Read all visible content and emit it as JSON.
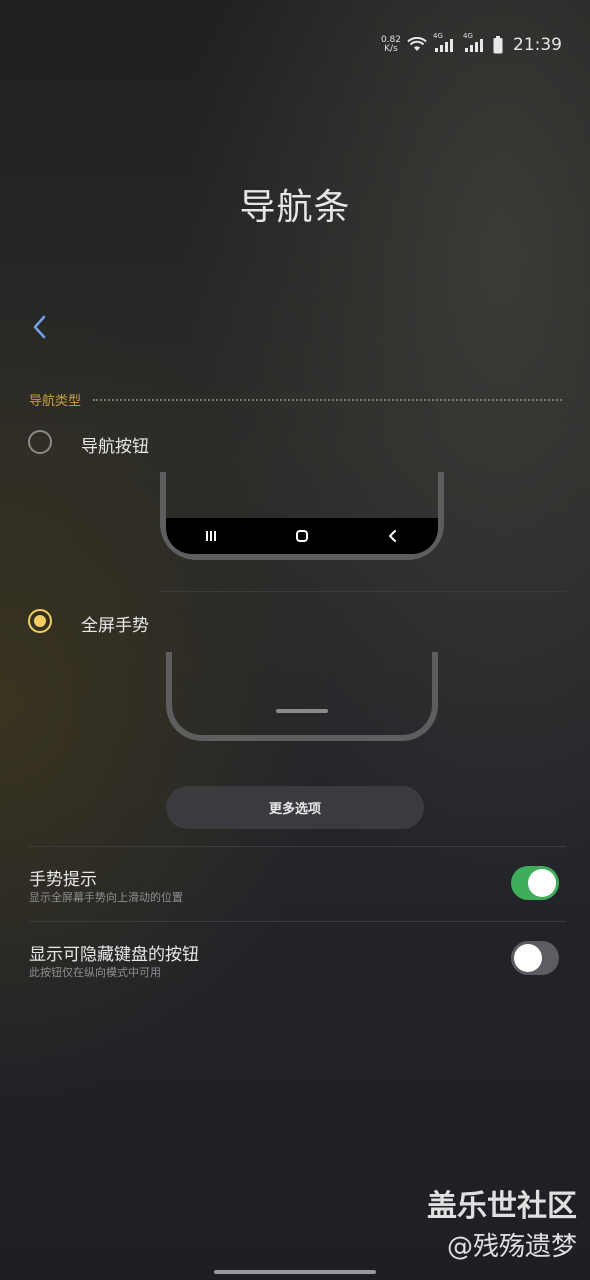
{
  "status_bar": {
    "speed_value": "0.82",
    "speed_unit": "K/s",
    "wifi_icon": "wifi-icon",
    "signal_1_label": "4G",
    "signal_2_label": "4G",
    "battery_icon": "battery-icon",
    "time": "21:39"
  },
  "page": {
    "title": "导航条"
  },
  "section": {
    "label": "导航类型"
  },
  "options": [
    {
      "label": "导航按钮",
      "selected": false
    },
    {
      "label": "全屏手势",
      "selected": true
    }
  ],
  "more_options_label": "更多选项",
  "settings": [
    {
      "title": "手势提示",
      "subtitle": "显示全屏幕手势向上滑动的位置",
      "enabled": true
    },
    {
      "title": "显示可隐藏键盘的按钮",
      "subtitle": "此按钮仅在纵向模式中可用",
      "enabled": false
    }
  ],
  "watermark": {
    "line1": "盖乐世社区",
    "line2": "@残殇遗梦"
  },
  "colors": {
    "accent": "#f2cd62",
    "section_label": "#c79e45",
    "toggle_on": "#3fae5a",
    "back": "#6ea0e8"
  }
}
